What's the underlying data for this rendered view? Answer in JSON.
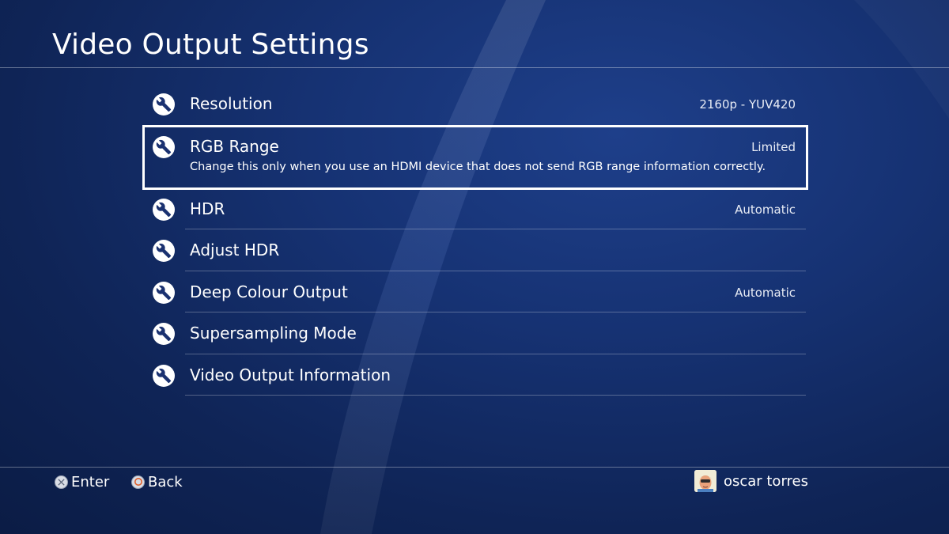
{
  "page": {
    "title": "Video Output Settings"
  },
  "menu": {
    "items": [
      {
        "label": "Resolution",
        "value": "2160p - YUV420",
        "icon": "wrench-icon"
      },
      {
        "label": "RGB Range",
        "value": "Limited",
        "description": "Change this only when you use an HDMI device that does not send RGB range information correctly.",
        "selected": true,
        "icon": "wrench-icon"
      },
      {
        "label": "HDR",
        "value": "Automatic",
        "icon": "wrench-icon"
      },
      {
        "label": "Adjust HDR",
        "value": "",
        "icon": "wrench-icon"
      },
      {
        "label": "Deep Colour Output",
        "value": "Automatic",
        "icon": "wrench-icon"
      },
      {
        "label": "Supersampling Mode",
        "value": "",
        "icon": "wrench-icon"
      },
      {
        "label": "Video Output Information",
        "value": "",
        "icon": "wrench-icon"
      }
    ]
  },
  "footer": {
    "enter_label": "Enter",
    "enter_icon": "cross-button-icon",
    "back_label": "Back",
    "back_icon": "circle-button-icon",
    "user_name": "oscar torres",
    "user_icon": "avatar"
  },
  "colors": {
    "background": "#163273",
    "selection_border": "#ffffff",
    "back_button_accent": "#e0602c"
  }
}
